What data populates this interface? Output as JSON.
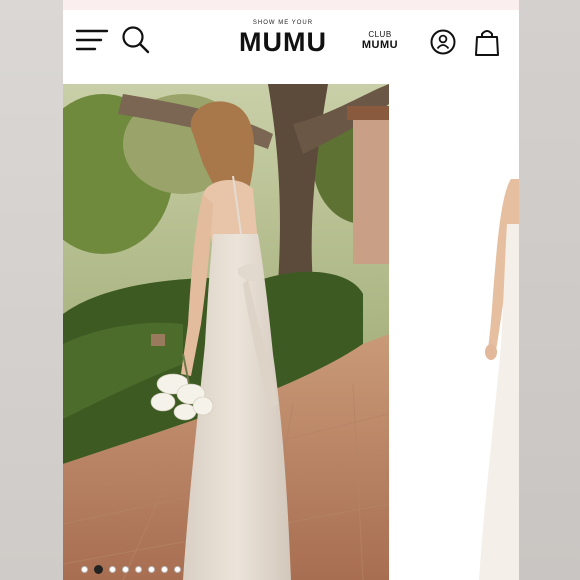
{
  "header": {
    "logo_small": "SHOW ME YOUR",
    "logo_big": "MUMU",
    "club_top": "CLUB",
    "club_bottom": "MUMU"
  },
  "icons": {
    "menu": "hamburger-menu-icon",
    "search": "search-icon",
    "account": "account-icon",
    "bag": "shopping-bag-icon"
  },
  "gallery": {
    "slide_count": 8,
    "active_slide": 1
  },
  "colors": {
    "dress": "#e4dcd2",
    "background_frame": "#d9d6d4",
    "top_strip": "#fbeeee"
  }
}
